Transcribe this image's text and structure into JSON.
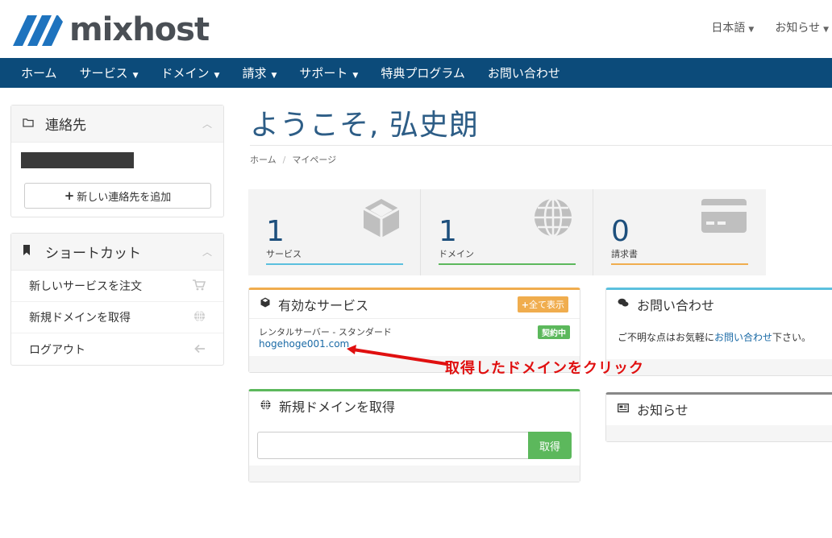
{
  "brand": {
    "name": "mixhost",
    "color": "#0c4b7a"
  },
  "header_links": [
    {
      "label": "日本語"
    },
    {
      "label": "お知らせ"
    }
  ],
  "nav": [
    {
      "label": "ホーム",
      "dropdown": false
    },
    {
      "label": "サービス",
      "dropdown": true
    },
    {
      "label": "ドメイン",
      "dropdown": true
    },
    {
      "label": "請求",
      "dropdown": true
    },
    {
      "label": "サポート",
      "dropdown": true
    },
    {
      "label": "特典プログラム",
      "dropdown": false
    },
    {
      "label": "お問い合わせ",
      "dropdown": false
    }
  ],
  "contacts_panel": {
    "title": "連絡先",
    "add_button": "新しい連絡先を追加"
  },
  "shortcuts_panel": {
    "title": "ショートカット",
    "items": [
      {
        "label": "新しいサービスを注文",
        "icon": "cart-icon"
      },
      {
        "label": "新規ドメインを取得",
        "icon": "globe-icon"
      },
      {
        "label": "ログアウト",
        "icon": "arrow-left-icon"
      }
    ]
  },
  "main": {
    "welcome": "ようこそ, 弘史朗",
    "breadcrumb": [
      "ホーム",
      "マイページ"
    ]
  },
  "stats": [
    {
      "value": "1",
      "label": "サービス",
      "color": "#5bc0de",
      "icon": "cube-icon"
    },
    {
      "value": "1",
      "label": "ドメイン",
      "color": "#5cb85c",
      "icon": "globe-icon"
    },
    {
      "value": "0",
      "label": "請求書",
      "color": "#f0ad4e",
      "icon": "credit-card-icon"
    }
  ],
  "active_services": {
    "title": "有効なサービス",
    "show_all": "全て表示",
    "service_name": "レンタルサーバー - スタンダード",
    "status": "契約中",
    "domain": "hogehoge001.com"
  },
  "register_domain": {
    "title": "新規ドメインを取得",
    "button": "取得"
  },
  "contact_card": {
    "title": "お問い合わせ",
    "text_before": "ご不明な点はお気軽に",
    "link": "お問い合わせ",
    "text_after": "下さい。"
  },
  "news_card": {
    "title": "お知らせ"
  },
  "annotation": {
    "text": "取得したドメインをクリック",
    "color": "#e01010"
  }
}
